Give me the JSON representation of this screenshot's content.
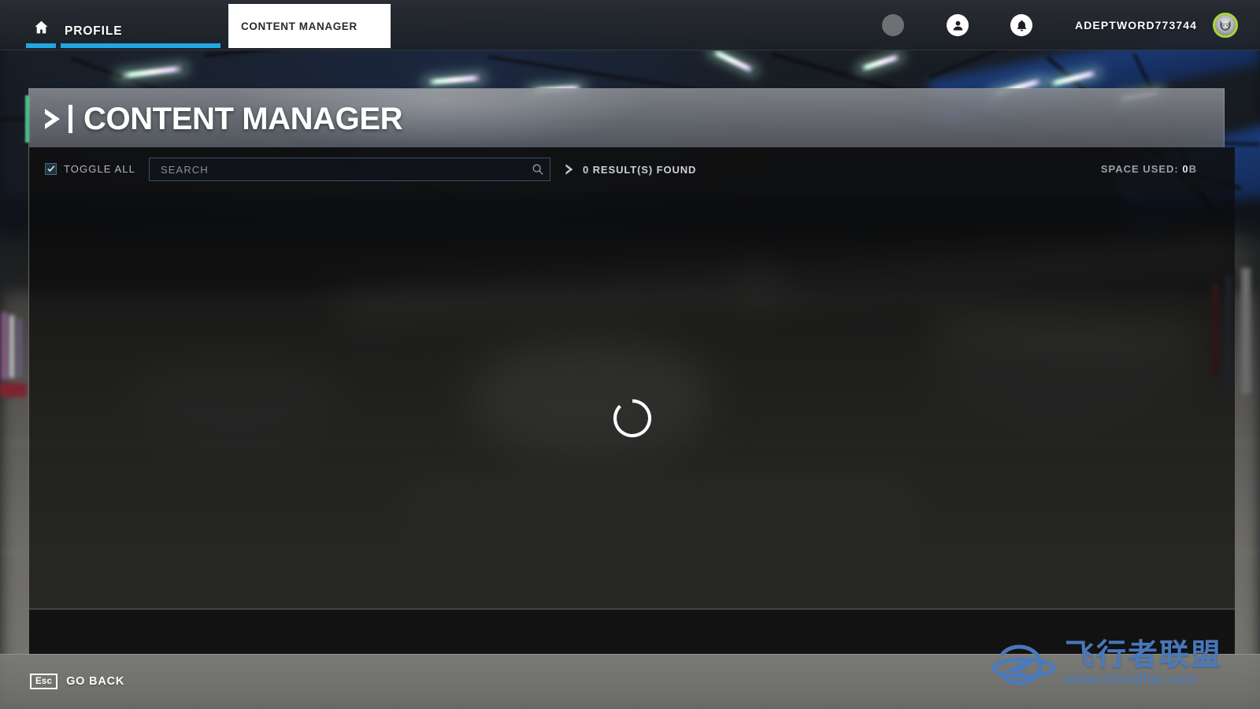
{
  "topnav": {
    "home_icon": "home-icon",
    "profile_label": "PROFILE",
    "active_tab_label": "CONTENT MANAGER",
    "friends_icon": "friends-icon",
    "account_icon": "account-icon",
    "notifications_icon": "bell-icon",
    "username": "ADEPTWORD773744",
    "avatar_icon": "wolf-avatar",
    "accent_color": "#1ea7e1",
    "avatar_ring_color": "#a8d633"
  },
  "panel": {
    "title": "CONTENT MANAGER",
    "title_chevron_icon": "chevron-right-icon"
  },
  "toolbar": {
    "toggle_all_label": "TOGGLE ALL",
    "toggle_all_checked": true,
    "check_icon": "check-icon",
    "search": {
      "value": "",
      "placeholder": "SEARCH",
      "icon": "search-icon"
    },
    "results_chevron_icon": "chevron-right-icon",
    "results_text": "0 RESULT(S) FOUND",
    "space_used_label": "SPACE USED: ",
    "space_used_value": "0",
    "space_used_unit": "B"
  },
  "content": {
    "loading_icon": "loading-spinner",
    "items": []
  },
  "bottombar": {
    "esc_key_label": "Esc",
    "go_back_label": "GO BACK"
  },
  "watermark": {
    "logo_icon": "plane-orbit-logo",
    "chinese_text": "飞行者联盟",
    "url": "www.chinaflier.com",
    "color": "#4a7bbf"
  }
}
